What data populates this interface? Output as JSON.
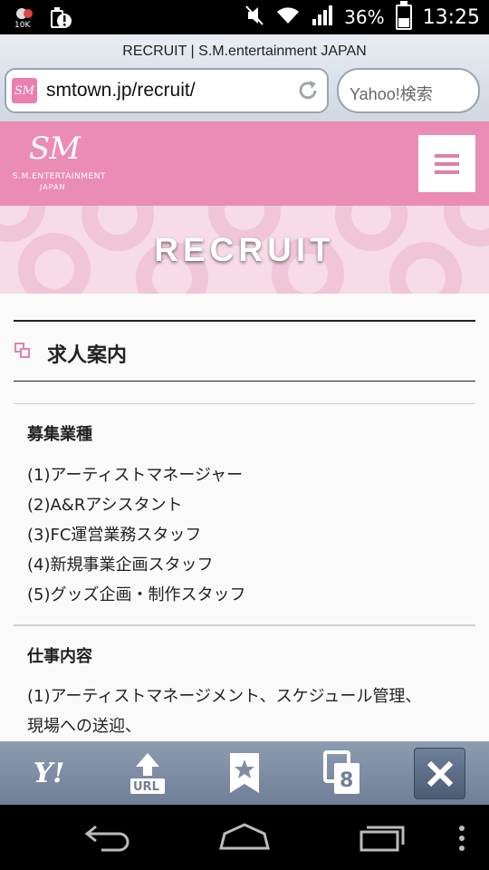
{
  "status_bar": {
    "battery_percent": "36%",
    "time": "13:25",
    "icons": [
      "notification-10-icon",
      "alert-icon",
      "mute-icon",
      "wifi-icon",
      "signal-icon",
      "battery-icon"
    ]
  },
  "browser": {
    "page_title": "RECRUIT | S.M.entertainment JAPAN",
    "url": "smtown.jp/recruit/",
    "search_placeholder": "Yahoo!検索",
    "favicon_text": "SM"
  },
  "site": {
    "logo_text": "SM",
    "logo_line1": "S.M.ENTERTAINMENT",
    "logo_line2": "JAPAN",
    "brand_color": "#ea8cb5",
    "hero_title": "RECRUIT"
  },
  "section": {
    "title": "求人案内",
    "job_types_heading": "募集業種",
    "job_types": [
      "(1)アーティストマネージャー",
      "(2)A&Rアシスタント",
      "(3)FC運営業務スタッフ",
      "(4)新規事業企画スタッフ",
      "(5)グッズ企画・制作スタッフ"
    ],
    "duties_heading": "仕事内容",
    "duties_line1": "(1)アーティストマネージメント、スケジュール管理、",
    "duties_line2": "現場への送迎、"
  },
  "toolbar": {
    "yahoo_label": "Y!",
    "url_label": "URL",
    "tabs_count": "8"
  }
}
